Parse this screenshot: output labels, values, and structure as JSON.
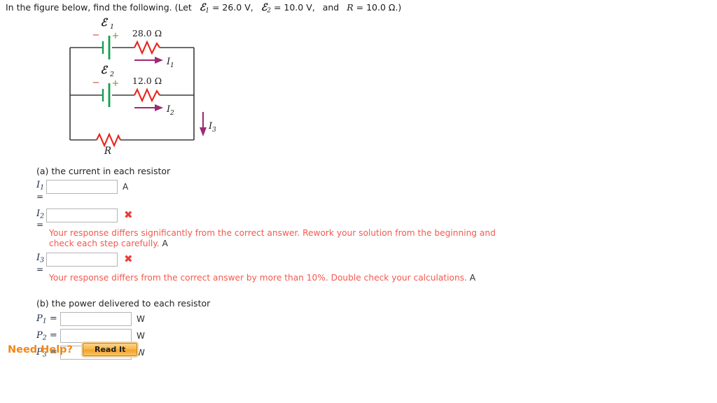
{
  "prompt": {
    "lead": "In the figure below, find the following. (Let",
    "emf1_symbol": "ℰ",
    "emf1_sub": "1",
    "emf1_value": "= 26.0 V,",
    "emf2_symbol": "ℰ",
    "emf2_sub": "2",
    "emf2_value": "= 10.0 V,",
    "and": "and",
    "r_symbol": "R",
    "r_value": "= 10.0 Ω.)"
  },
  "figure": {
    "emf1_label": "ℰ",
    "emf1_sub": "1",
    "emf2_label": "ℰ",
    "emf2_sub": "2",
    "battery1_minus": "−",
    "battery1_plus": "+",
    "battery2_minus": "−",
    "battery2_plus": "+",
    "resistor1_label": "28.0 Ω",
    "resistor2_label": "12.0 Ω",
    "resistor3_label": "R",
    "current1_label": "I",
    "current1_sub": "1",
    "current2_label": "I",
    "current2_sub": "2",
    "current3_label": "I",
    "current3_sub": "3",
    "colors": {
      "wire": "#3b3b3b",
      "resistor": "#e8241b",
      "battery": "#10a24e",
      "current_arrow": "#9c2b73",
      "plus_sign": "#6d8a3a",
      "minus_sign": "#d03a2a",
      "label": "#1a1a1a"
    }
  },
  "parts": {
    "a": {
      "heading": "(a) the current in each resistor",
      "rows": [
        {
          "label": "I",
          "sub": "1",
          "eq": "=",
          "value": "",
          "placeholder": "",
          "unit": "A",
          "status": "none",
          "feedback": ""
        },
        {
          "label": "I",
          "sub": "2",
          "eq": "=",
          "value": "",
          "placeholder": "",
          "unit": "A",
          "status": "incorrect",
          "mark": "✖",
          "feedback": "Your response differs significantly from the correct answer. Rework your solution from the beginning and check each step carefully."
        },
        {
          "label": "I",
          "sub": "3",
          "eq": "=",
          "value": "",
          "placeholder": "",
          "unit": "A",
          "status": "incorrect",
          "mark": "✖",
          "feedback": "Your response differs from the correct answer by more than 10%. Double check your calculations."
        }
      ]
    },
    "b": {
      "heading": "(b) the power delivered to each resistor",
      "rows": [
        {
          "label": "P",
          "sub": "1",
          "eq": "=",
          "value": "",
          "placeholder": "",
          "unit": "W"
        },
        {
          "label": "P",
          "sub": "2",
          "eq": "=",
          "value": "",
          "placeholder": "",
          "unit": "W"
        },
        {
          "label": "P",
          "sub": "3",
          "eq": "=",
          "value": "",
          "placeholder": "",
          "unit": "W"
        }
      ]
    }
  },
  "help": {
    "title": "Need Help?",
    "button_label": "Read It"
  }
}
